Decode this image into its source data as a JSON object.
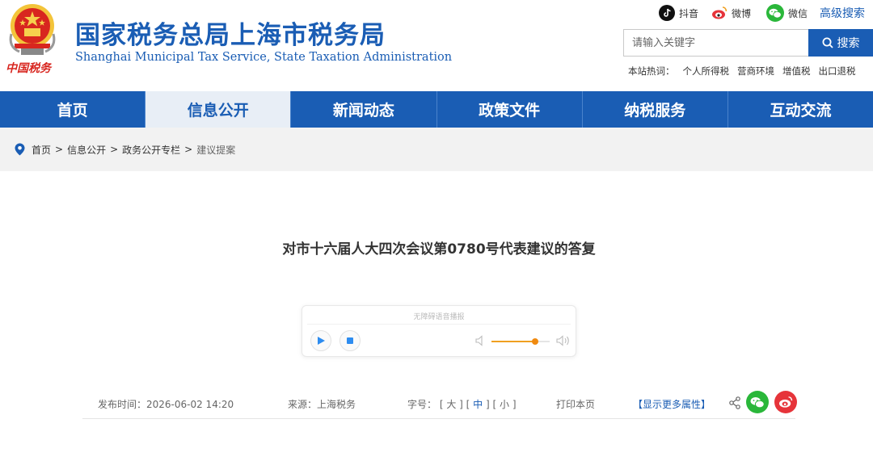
{
  "header": {
    "title": "国家税务总局上海市税务局",
    "subtitle": "Shanghai Municipal Tax Service, State Taxation Administration",
    "emblem_text": "中国税务",
    "social": [
      {
        "icon": "douyin-icon",
        "label": "抖音"
      },
      {
        "icon": "weibo-icon",
        "label": "微博"
      },
      {
        "icon": "weixin-icon",
        "label": "微信"
      }
    ],
    "advanced_search": "高级搜索",
    "search": {
      "placeholder": "请输入关键字",
      "button_label": "搜索"
    },
    "hot_label": "本站热词：",
    "hot_words": [
      "个人所得税",
      "营商环境",
      "增值税",
      "出口退税"
    ]
  },
  "nav": {
    "items": [
      "首页",
      "信息公开",
      "新闻动态",
      "政策文件",
      "纳税服务",
      "互动交流"
    ],
    "active_index": 1
  },
  "breadcrumb": {
    "items": [
      "首页",
      "信息公开",
      "政务公开专栏"
    ],
    "separator": ">",
    "current": "建议提案"
  },
  "article": {
    "title": "对市十六届人大四次会议第0780号代表建议的答复",
    "player": {
      "label": "无障碍语音播报",
      "volume": 0.75
    },
    "meta": {
      "date": "发布时间：2026-06-02 14:20",
      "source": "来源：上海税务",
      "font_size_label": "字号：",
      "font_sizes": [
        "大",
        "中",
        "小"
      ],
      "font_size_active": "中",
      "print": "打印本页",
      "more": "【显示更多属性】"
    }
  },
  "colors": {
    "brand_blue": "#1a5db4",
    "wechat_green": "#2ab73a",
    "weibo_red": "#e6343a",
    "volume_orange": "#f08a10"
  }
}
